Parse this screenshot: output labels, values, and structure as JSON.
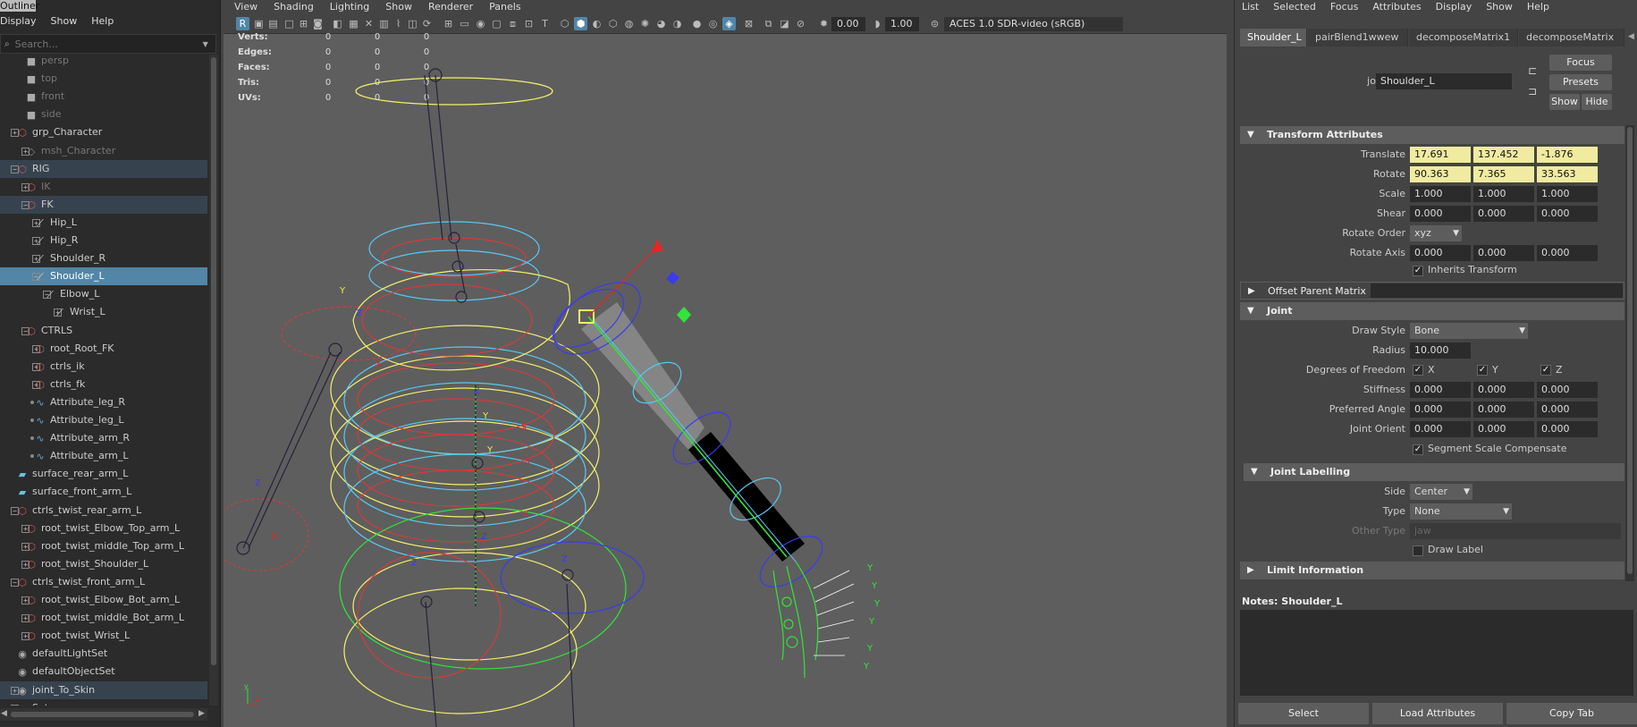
{
  "outliner": {
    "title": "Outliner",
    "menu": [
      "Display",
      "Show",
      "Help"
    ],
    "search_placeholder": "Search...",
    "items": [
      {
        "label": "persp",
        "dim": true
      },
      {
        "label": "top",
        "dim": true
      },
      {
        "label": "front",
        "dim": true
      },
      {
        "label": "side",
        "dim": true
      },
      {
        "label": "grp_Character"
      },
      {
        "label": "msh_Character",
        "dim": true
      },
      {
        "label": "RIG"
      },
      {
        "label": "IK",
        "dim": true
      },
      {
        "label": "FK"
      },
      {
        "label": "Hip_L"
      },
      {
        "label": "Hip_R"
      },
      {
        "label": "Shoulder_R"
      },
      {
        "label": "Shoulder_L"
      },
      {
        "label": "Elbow_L"
      },
      {
        "label": "Wrist_L"
      },
      {
        "label": "CTRLS"
      },
      {
        "label": "root_Root_FK"
      },
      {
        "label": "ctrls_ik"
      },
      {
        "label": "ctrls_fk"
      },
      {
        "label": "Attribute_leg_R"
      },
      {
        "label": "Attribute_leg_L"
      },
      {
        "label": "Attribute_arm_R"
      },
      {
        "label": "Attribute_arm_L"
      },
      {
        "label": "surface_rear_arm_L"
      },
      {
        "label": "surface_front_arm_L"
      },
      {
        "label": "ctrls_twist_rear_arm_L"
      },
      {
        "label": "root_twist_Elbow_Top_arm_L"
      },
      {
        "label": "root_twist_middle_Top_arm_L"
      },
      {
        "label": "root_twist_Shoulder_L"
      },
      {
        "label": "ctrls_twist_front_arm_L"
      },
      {
        "label": "root_twist_Elbow_Bot_arm_L"
      },
      {
        "label": "root_twist_middle_Bot_arm_L"
      },
      {
        "label": "root_twist_Wrist_L"
      },
      {
        "label": "defaultLightSet"
      },
      {
        "label": "defaultObjectSet"
      },
      {
        "label": "joint_To_Skin"
      },
      {
        "label": "Sets"
      }
    ]
  },
  "viewport": {
    "menu": [
      "View",
      "Shading",
      "Lighting",
      "Show",
      "Renderer",
      "Panels"
    ],
    "exposure": "0.00",
    "gamma": "1.00",
    "color_space": "ACES 1.0 SDR-video (sRGB)",
    "hud": [
      {
        "label": "Verts:",
        "values": [
          "0",
          "0",
          "0"
        ]
      },
      {
        "label": "Edges:",
        "values": [
          "0",
          "0",
          "0"
        ]
      },
      {
        "label": "Faces:",
        "values": [
          "0",
          "0",
          "0"
        ]
      },
      {
        "label": "Tris:",
        "values": [
          "0",
          "0",
          "0"
        ]
      },
      {
        "label": "UVs:",
        "values": [
          "0",
          "0",
          "0"
        ]
      }
    ]
  },
  "attribute_editor": {
    "menu": [
      "List",
      "Selected",
      "Focus",
      "Attributes",
      "Display",
      "Show",
      "Help"
    ],
    "tabs": [
      "Shoulder_L",
      "pairBlend1wwew",
      "decomposeMatrix1",
      "decomposeMatrix"
    ],
    "node_type_label": "joint:",
    "node_name": "Shoulder_L",
    "buttons": {
      "focus": "Focus",
      "presets": "Presets",
      "show": "Show",
      "hide": "Hide"
    },
    "transform": {
      "title": "Transform Attributes",
      "translate_label": "Translate",
      "translate": [
        "17.691",
        "137.452",
        "-1.876"
      ],
      "rotate_label": "Rotate",
      "rotate": [
        "90.363",
        "7.365",
        "33.563"
      ],
      "scale_label": "Scale",
      "scale": [
        "1.000",
        "1.000",
        "1.000"
      ],
      "shear_label": "Shear",
      "shear": [
        "0.000",
        "0.000",
        "0.000"
      ],
      "rotate_order_label": "Rotate Order",
      "rotate_order": "xyz",
      "rotate_axis_label": "Rotate Axis",
      "rotate_axis": [
        "0.000",
        "0.000",
        "0.000"
      ],
      "inherits_label": "Inherits Transform"
    },
    "offset_parent_title": "Offset Parent Matrix",
    "joint": {
      "title": "Joint",
      "draw_style_label": "Draw Style",
      "draw_style": "Bone",
      "radius_label": "Radius",
      "radius": "10.000",
      "dof_label": "Degrees of Freedom",
      "dof": [
        "X",
        "Y",
        "Z"
      ],
      "stiffness_label": "Stiffness",
      "stiffness": [
        "0.000",
        "0.000",
        "0.000"
      ],
      "preferred_label": "Preferred Angle",
      "preferred": [
        "0.000",
        "0.000",
        "0.000"
      ],
      "orient_label": "Joint Orient",
      "orient": [
        "0.000",
        "0.000",
        "0.000"
      ],
      "ssc_label": "Segment Scale Compensate"
    },
    "labelling": {
      "title": "Joint Labelling",
      "side_label": "Side",
      "side": "Center",
      "type_label": "Type",
      "type": "None",
      "other_label": "Other Type",
      "other": "jaw",
      "draw_label": "Draw Label"
    },
    "limit_title": "Limit Information",
    "notes_label": "Notes:",
    "notes_node": "Shoulder_L",
    "bottom_buttons": [
      "Select",
      "Load Attributes",
      "Copy Tab"
    ]
  }
}
